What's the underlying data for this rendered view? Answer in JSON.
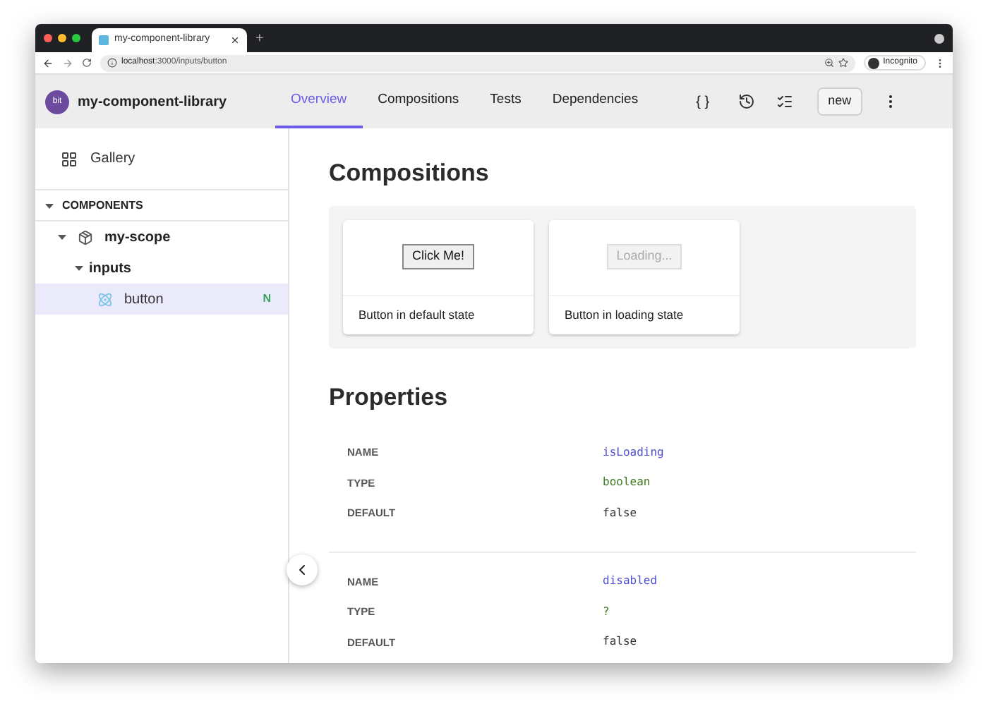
{
  "browser": {
    "tab_title": "my-component-library",
    "tab_plus": "+",
    "url_host": "localhost",
    "url_path": ":3000/inputs/button",
    "profile": "Incognito"
  },
  "header": {
    "logo": "bit",
    "title": "my-component-library",
    "tabs": [
      {
        "label": "Overview",
        "selected": true
      },
      {
        "label": "Compositions",
        "selected": false
      },
      {
        "label": "Tests",
        "selected": false
      },
      {
        "label": "Dependencies",
        "selected": false
      }
    ],
    "code_symbol": "{ }",
    "new_button": "new"
  },
  "sidebar": {
    "gallery": "Gallery",
    "section": "COMPONENTS",
    "tree": [
      {
        "label": "my-scope",
        "kind": "scope",
        "expanded": true,
        "children": [
          {
            "label": "inputs",
            "expanded": true,
            "children": [
              {
                "label": "button",
                "kind": "component",
                "selected": true,
                "badge": "N"
              }
            ]
          }
        ]
      }
    ]
  },
  "compositions": {
    "title": "Compositions",
    "items": [
      {
        "caption": "Button in default state",
        "button": "Click Me!",
        "disabled": false
      },
      {
        "caption": "Button in loading state",
        "button": "Loading...",
        "disabled": true
      }
    ]
  },
  "properties": {
    "title": "Properties",
    "items": [
      {
        "fields": [
          {
            "label": "NAME",
            "value": "isLoading",
            "kind": "name"
          },
          {
            "label": "TYPE",
            "value": "boolean",
            "kind": "type"
          },
          {
            "label": "DEFAULT",
            "value": "false",
            "kind": "default"
          }
        ]
      },
      {
        "fields": [
          {
            "label": "NAME",
            "value": "disabled",
            "kind": "name"
          },
          {
            "label": "TYPE",
            "value": "?",
            "kind": "type"
          },
          {
            "label": "DEFAULT",
            "value": "false",
            "kind": "default"
          }
        ]
      }
    ]
  }
}
